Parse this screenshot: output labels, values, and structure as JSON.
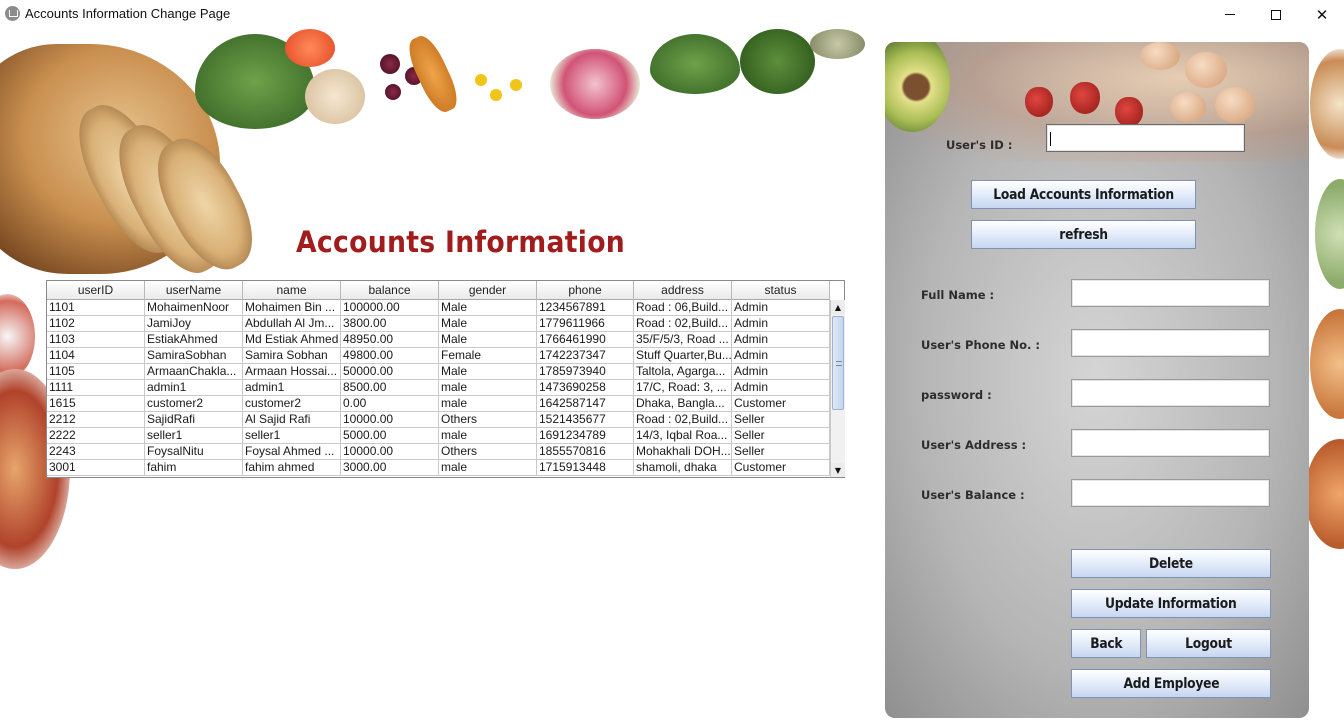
{
  "window": {
    "title": "Accounts Information Change Page",
    "controls": {
      "minimize": "—",
      "maximize": "☐",
      "close": "✕"
    }
  },
  "heading": "Accounts Information",
  "table": {
    "columns": [
      "userID",
      "userName",
      "name",
      "balance",
      "gender",
      "phone",
      "address",
      "status"
    ],
    "rows": [
      [
        "1101",
        "MohaimenNoor",
        "Mohaimen Bin ...",
        "100000.00",
        "Male",
        "1234567891",
        "Road : 06,Build...",
        "Admin"
      ],
      [
        "1102",
        "JamiJoy",
        "Abdullah Al Jm...",
        "3800.00",
        "Male",
        "1779611966",
        "Road : 02,Build...",
        "Admin"
      ],
      [
        "1103",
        "EstiakAhmed",
        "Md Estiak Ahmed",
        "48950.00",
        "Male",
        "1766461990",
        "35/F/5/3, Road ...",
        "Admin"
      ],
      [
        "1104",
        "SamiraSobhan",
        "Samira Sobhan",
        "49800.00",
        "Female",
        "1742237347",
        "Stuff Quarter,Bu...",
        "Admin"
      ],
      [
        "1105",
        "ArmaanChakla...",
        "Armaan Hossai...",
        "50000.00",
        "Male",
        "1785973940",
        "Taltola, Agarga...",
        "Admin"
      ],
      [
        "1111",
        "admin1",
        "admin1",
        "8500.00",
        "male",
        "1473690258",
        "17/C, Road: 3, ...",
        "Admin"
      ],
      [
        "1615",
        "customer2",
        "customer2",
        "0.00",
        "male",
        "1642587147",
        "Dhaka, Bangla...",
        "Customer"
      ],
      [
        "2212",
        "SajidRafi",
        "Al Sajid Rafi",
        "10000.00",
        "Others",
        "1521435677",
        "Road : 02,Build...",
        "Seller"
      ],
      [
        "2222",
        "seller1",
        "seller1",
        "5000.00",
        "male",
        "1691234789",
        "14/3, Iqbal Roa...",
        "Seller"
      ],
      [
        "2243",
        "FoysalNitu",
        "Foysal Ahmed ...",
        "10000.00",
        "Others",
        "1855570816",
        "Mohakhali DOH...",
        "Seller"
      ],
      [
        "3001",
        "fahim",
        "fahim ahmed",
        "3000.00",
        "male",
        "1715913448",
        "shamoli, dhaka",
        "Customer"
      ]
    ],
    "scroll_up": "▲",
    "scroll_down": "▼"
  },
  "panel": {
    "user_id_label": "User's ID :",
    "user_id_value": "",
    "load_button": "Load Accounts Information",
    "refresh_button": "refresh",
    "full_name_label": "Full Name :",
    "phone_label": "User's Phone No. :",
    "password_label": "password :",
    "address_label": "User's Address :",
    "balance_label": "User's Balance :",
    "full_name_value": "",
    "phone_value": "",
    "password_value": "",
    "address_value": "",
    "balance_value": "",
    "delete_button": "Delete",
    "update_button": "Update Information",
    "back_button": "Back",
    "logout_button": "Logout",
    "add_employee_button": "Add Employee"
  },
  "colors": {
    "heading": "#a11d1d",
    "button_gradient_bottom": "#c6d6f0",
    "panel_gray": "#b5b5b5"
  }
}
